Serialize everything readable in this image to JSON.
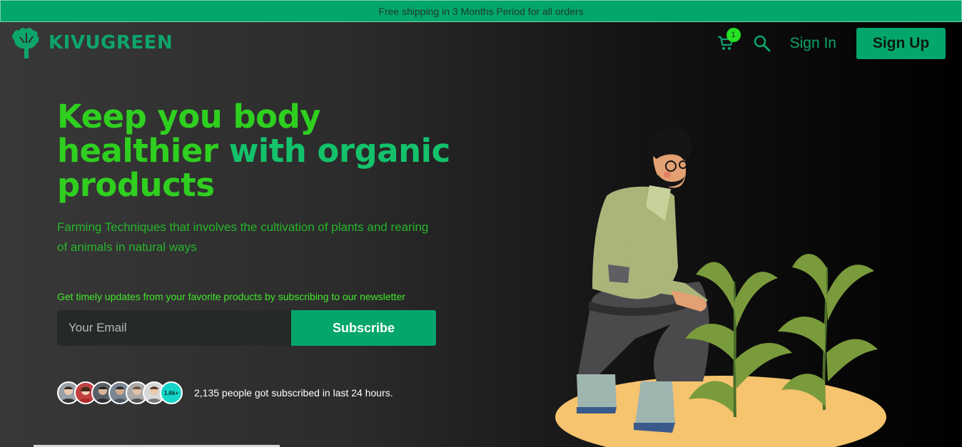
{
  "announcement": "Free shipping in 3 Months Period for all orders",
  "brand": {
    "name": "KIVUGREEN",
    "logo_icon": "tree-icon"
  },
  "nav": {
    "cart_icon": "cart-icon",
    "cart_count": "1",
    "search_icon": "search-icon",
    "signin_label": "Sign In",
    "signup_label": "Sign Up"
  },
  "hero": {
    "title_line1": "Keep you body",
    "title_line2a": "healthier",
    "title_line2b": "with organic",
    "title_line3": "products",
    "subtitle": "Farming Techniques that involves the cultivation of plants and rearing of animals in natural ways"
  },
  "newsletter": {
    "label": "Get timely updates from your favorite products by subscribing to our newsletter",
    "email_placeholder": "Your Email",
    "subscribe_label": "Subscribe"
  },
  "social_proof": {
    "count_badge": "1.6k+",
    "text": "2,135 people got subscribed in last 24 hours."
  },
  "colors": {
    "brand_green": "#03a66b",
    "headline_green": "#2fcf1f",
    "badge_green": "#25e024",
    "badge_teal": "#16d5c9"
  }
}
